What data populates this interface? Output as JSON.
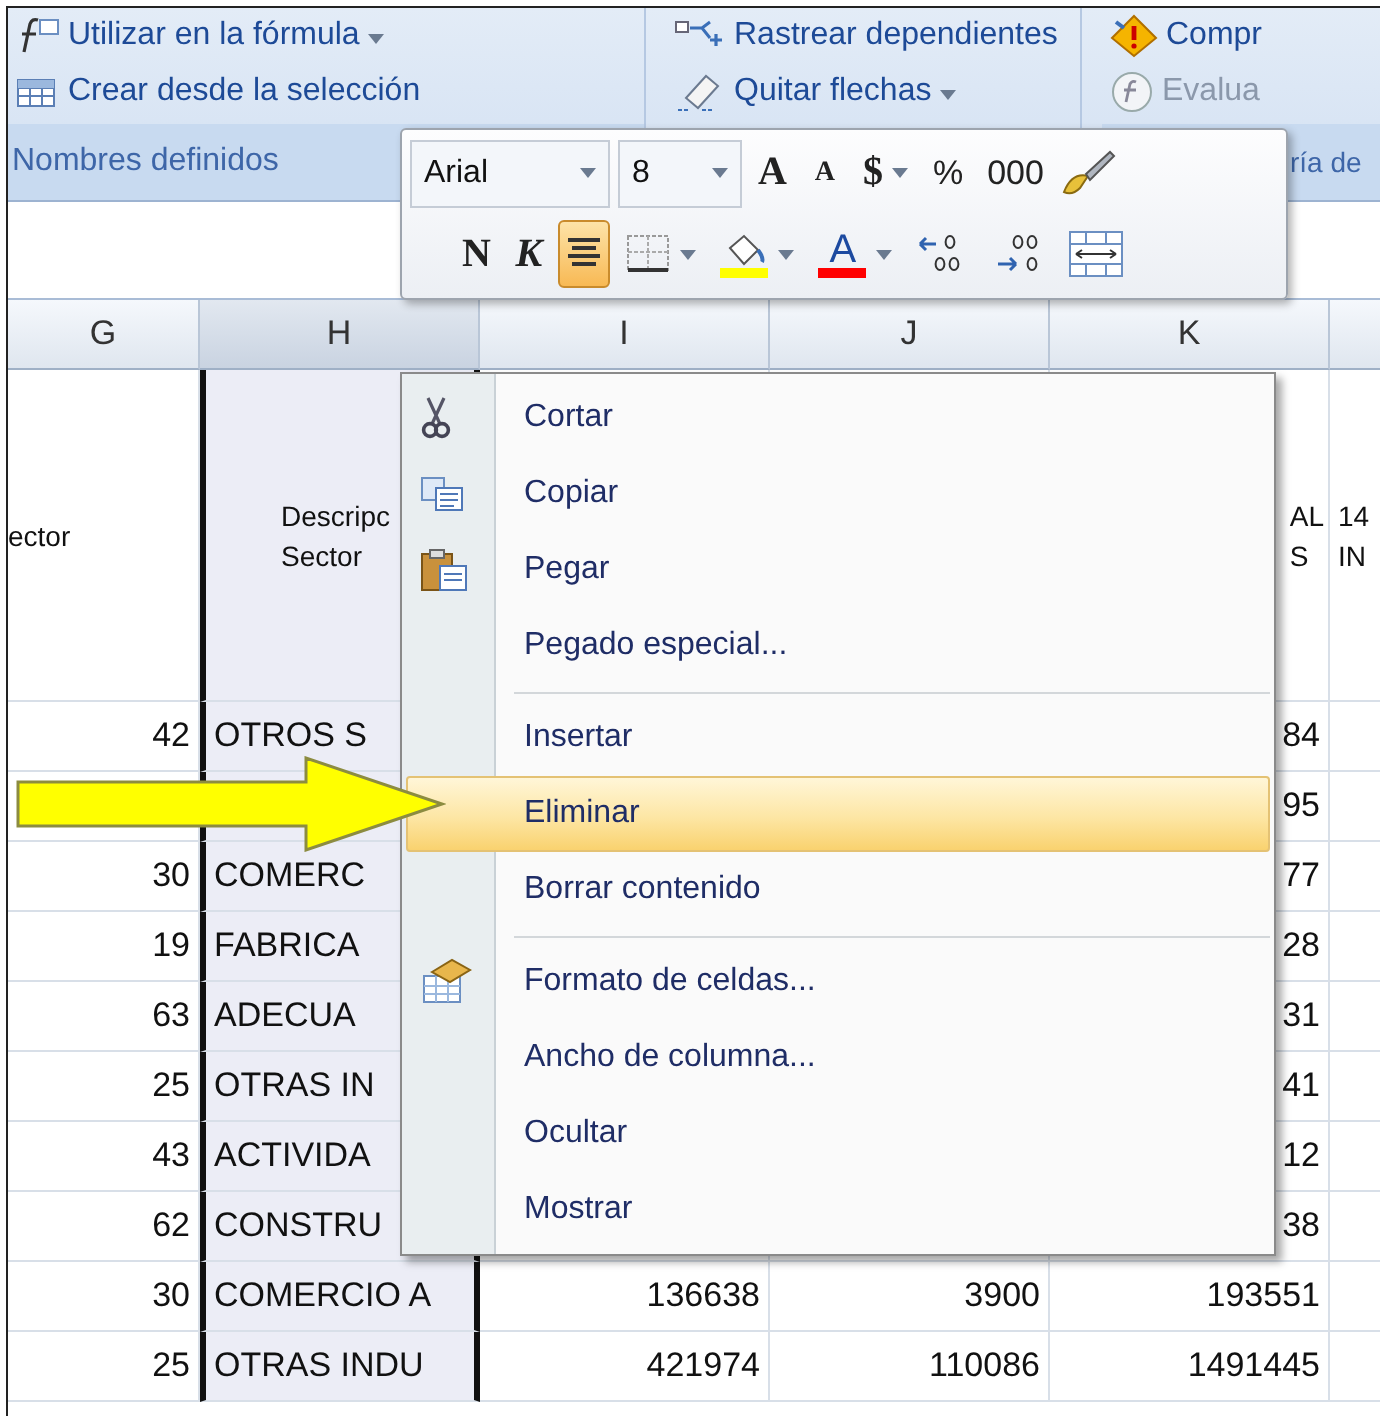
{
  "ribbon": {
    "left": [
      {
        "label": "Utilizar en la fórmula",
        "dropdown": true,
        "disabled": false
      },
      {
        "label": "Crear desde la selección",
        "dropdown": false,
        "disabled": false
      }
    ],
    "middle": [
      {
        "label": "Rastrear dependientes",
        "dropdown": false,
        "disabled": false
      },
      {
        "label": "Quitar flechas",
        "dropdown": true,
        "disabled": false
      }
    ],
    "right": [
      {
        "label": "Compr",
        "dropdown": false,
        "disabled": false
      },
      {
        "label": "Evalua",
        "dropdown": false,
        "disabled": true
      }
    ],
    "group_label": "Nombres definidos",
    "group_label_2": "ría de"
  },
  "toolbar": {
    "font": "Arial",
    "size": "8",
    "row1": [
      {
        "kind": "grow",
        "label": "A"
      },
      {
        "kind": "shrink",
        "label": "A"
      },
      {
        "kind": "currency",
        "label": "$",
        "dropdown": true
      },
      {
        "kind": "percent",
        "label": "%"
      },
      {
        "kind": "thousands",
        "label": "000"
      },
      {
        "kind": "brush"
      }
    ],
    "row2": [
      {
        "kind": "bold",
        "label": "N",
        "selected": false
      },
      {
        "kind": "italic",
        "label": "K",
        "selected": false
      },
      {
        "kind": "center",
        "selected": true
      },
      {
        "kind": "borders",
        "dropdown": true,
        "selected": false
      },
      {
        "kind": "fill",
        "dropdown": true,
        "color": "#ffff00",
        "selected": false
      },
      {
        "kind": "fontcolor",
        "label": "A",
        "dropdown": true,
        "color": "#ff0000",
        "selected": false
      },
      {
        "kind": "incdec",
        "selected": false
      },
      {
        "kind": "decdec",
        "selected": false
      },
      {
        "kind": "merge",
        "selected": false
      }
    ]
  },
  "columns": [
    {
      "letter": "G",
      "selected": false
    },
    {
      "letter": "H",
      "selected": true
    },
    {
      "letter": "I",
      "selected": false
    },
    {
      "letter": "J",
      "selected": false
    },
    {
      "letter": "K",
      "selected": false
    }
  ],
  "header_row": {
    "g": [
      "ector"
    ],
    "h": [
      "Descripc",
      "Sector"
    ],
    "k": [
      "AL",
      "S"
    ],
    "l": [
      "14",
      "IN"
    ]
  },
  "rows": [
    {
      "g": "42",
      "h": "OTROS S",
      "k": "84"
    },
    {
      "k": "95"
    },
    {
      "g": "30",
      "h": "COMERC",
      "k": "77"
    },
    {
      "g": "19",
      "h": "FABRICA",
      "k": "28"
    },
    {
      "g": "63",
      "h": "ADECUA",
      "k": "31"
    },
    {
      "g": "25",
      "h": "OTRAS IN",
      "k": "41"
    },
    {
      "g": "43",
      "h": "ACTIVIDA",
      "k": "12"
    },
    {
      "g": "62",
      "h": "CONSTRU",
      "k": "38"
    },
    {
      "g": "30",
      "h": "COMERCIO A",
      "i": "136638",
      "j": "3900",
      "k": "193551"
    },
    {
      "g": "25",
      "h": "OTRAS INDU",
      "i": "421974",
      "j": "110086",
      "k": "1491445"
    }
  ],
  "context_menu": [
    {
      "label": "Cortar",
      "selected": false,
      "separator_before": false
    },
    {
      "label": "Copiar",
      "selected": false,
      "separator_before": false
    },
    {
      "label": "Pegar",
      "selected": false,
      "separator_before": false
    },
    {
      "label": "Pegado especial...",
      "selected": false,
      "separator_before": false
    },
    {
      "label": "Insertar",
      "selected": false,
      "separator_before": true
    },
    {
      "label": "Eliminar",
      "selected": true,
      "separator_before": false
    },
    {
      "label": "Borrar contenido",
      "selected": false,
      "separator_before": false
    },
    {
      "label": "Formato de celdas...",
      "selected": false,
      "separator_before": true
    },
    {
      "label": "Ancho de columna...",
      "selected": false,
      "separator_before": false
    },
    {
      "label": "Ocultar",
      "selected": false,
      "separator_before": false
    },
    {
      "label": "Mostrar",
      "selected": false,
      "separator_before": false
    }
  ]
}
